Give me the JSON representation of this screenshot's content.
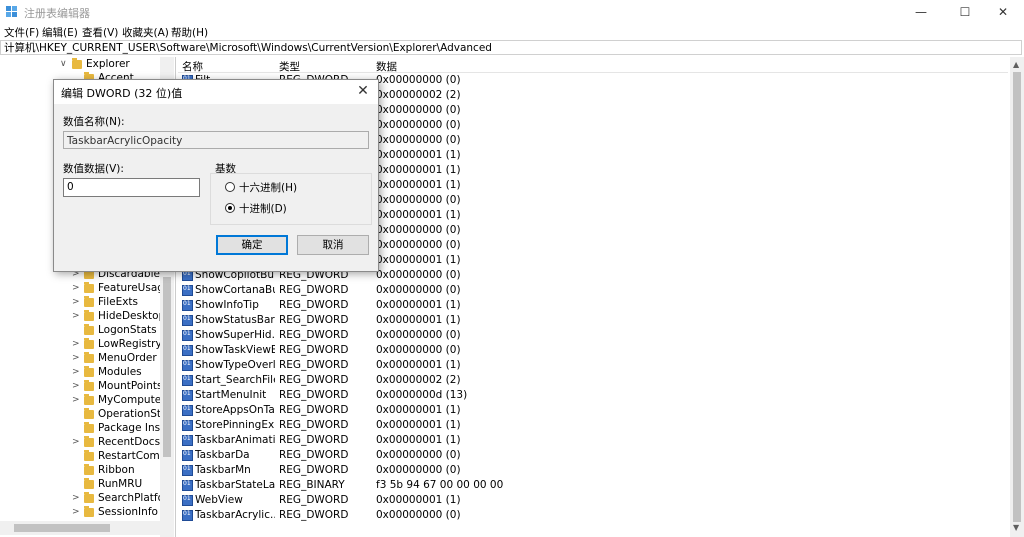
{
  "window": {
    "title": "注册表编辑器",
    "controls": [
      "—",
      "☐",
      "✕"
    ]
  },
  "menu": [
    "文件(F)",
    "编辑(E)",
    "查看(V)",
    "收藏夹(A)",
    "帮助(H)"
  ],
  "address": "计算机\\HKEY_CURRENT_USER\\Software\\Microsoft\\Windows\\CurrentVersion\\Explorer\\Advanced",
  "tree": {
    "root": {
      "label": "Explorer",
      "arrow": "∨"
    },
    "items": [
      {
        "label": "Accent",
        "arrow": ""
      },
      {
        "label": "Discardable",
        "arrow": ">"
      },
      {
        "label": "FeatureUsage",
        "arrow": ">"
      },
      {
        "label": "FileExts",
        "arrow": ">"
      },
      {
        "label": "HideDesktop",
        "arrow": ">"
      },
      {
        "label": "LogonStats",
        "arrow": ""
      },
      {
        "label": "LowRegistry",
        "arrow": ">"
      },
      {
        "label": "MenuOrder",
        "arrow": ">"
      },
      {
        "label": "Modules",
        "arrow": ">"
      },
      {
        "label": "MountPoints2",
        "arrow": ">"
      },
      {
        "label": "MyComputer",
        "arrow": ">"
      },
      {
        "label": "OperationSta",
        "arrow": ""
      },
      {
        "label": "Package Insta",
        "arrow": ""
      },
      {
        "label": "RecentDocs",
        "arrow": ">"
      },
      {
        "label": "RestartComm",
        "arrow": ""
      },
      {
        "label": "Ribbon",
        "arrow": ""
      },
      {
        "label": "RunMRU",
        "arrow": ""
      },
      {
        "label": "SearchPlatfor",
        "arrow": ">"
      },
      {
        "label": "SessionInfo",
        "arrow": ">"
      }
    ]
  },
  "columns": {
    "name": "名称",
    "type": "类型",
    "data": "数据"
  },
  "rows": [
    {
      "name": "Filt",
      "type": "REG_DWORD",
      "data": "0x00000000 (0)"
    },
    {
      "name": "",
      "type": "",
      "data": "0x00000002 (2)"
    },
    {
      "name": "",
      "type": "",
      "data": "0x00000000 (0)"
    },
    {
      "name": "",
      "type": "",
      "data": "0x00000000 (0)"
    },
    {
      "name": "",
      "type": "",
      "data": "0x00000000 (0)"
    },
    {
      "name": "",
      "type": "",
      "data": "0x00000001 (1)"
    },
    {
      "name": "",
      "type": "",
      "data": "0x00000001 (1)"
    },
    {
      "name": "",
      "type": "",
      "data": "0x00000001 (1)"
    },
    {
      "name": "",
      "type": "",
      "data": "0x00000000 (0)"
    },
    {
      "name": "",
      "type": "",
      "data": "0x00000001 (1)"
    },
    {
      "name": "",
      "type": "",
      "data": "0x00000000 (0)"
    },
    {
      "name": "",
      "type": "",
      "data": "0x00000000 (0)"
    },
    {
      "name": "",
      "type": "",
      "data": "0x00000001 (1)"
    },
    {
      "name": "ShowCopilotBu...",
      "type": "REG_DWORD",
      "data": "0x00000000 (0)"
    },
    {
      "name": "ShowCortanaBu...",
      "type": "REG_DWORD",
      "data": "0x00000000 (0)"
    },
    {
      "name": "ShowInfoTip",
      "type": "REG_DWORD",
      "data": "0x00000001 (1)"
    },
    {
      "name": "ShowStatusBar",
      "type": "REG_DWORD",
      "data": "0x00000001 (1)"
    },
    {
      "name": "ShowSuperHid...",
      "type": "REG_DWORD",
      "data": "0x00000000 (0)"
    },
    {
      "name": "ShowTaskViewB...",
      "type": "REG_DWORD",
      "data": "0x00000000 (0)"
    },
    {
      "name": "ShowTypeOverl...",
      "type": "REG_DWORD",
      "data": "0x00000001 (1)"
    },
    {
      "name": "Start_SearchFiles",
      "type": "REG_DWORD",
      "data": "0x00000002 (2)"
    },
    {
      "name": "StartMenuInit",
      "type": "REG_DWORD",
      "data": "0x0000000d (13)"
    },
    {
      "name": "StoreAppsOnTa...",
      "type": "REG_DWORD",
      "data": "0x00000001 (1)"
    },
    {
      "name": "StorePinningEx...",
      "type": "REG_DWORD",
      "data": "0x00000001 (1)"
    },
    {
      "name": "TaskbarAnimati...",
      "type": "REG_DWORD",
      "data": "0x00000001 (1)"
    },
    {
      "name": "TaskbarDa",
      "type": "REG_DWORD",
      "data": "0x00000000 (0)"
    },
    {
      "name": "TaskbarMn",
      "type": "REG_DWORD",
      "data": "0x00000000 (0)"
    },
    {
      "name": "TaskbarStateLa...",
      "type": "REG_BINARY",
      "data": "f3 5b 94 67 00 00 00 00"
    },
    {
      "name": "WebView",
      "type": "REG_DWORD",
      "data": "0x00000001 (1)"
    },
    {
      "name": "TaskbarAcrylic...",
      "type": "REG_DWORD",
      "data": "0x00000000 (0)"
    }
  ],
  "dialog": {
    "title": "编辑 DWORD (32 位)值",
    "close": "✕",
    "name_label": "数值名称(N):",
    "name_value": "TaskbarAcrylicOpacity",
    "data_label": "数值数据(V):",
    "data_value": "0",
    "base_label": "基数",
    "hex_label": "十六进制(H)",
    "dec_label": "十进制(D)",
    "ok": "确定",
    "cancel": "取消"
  },
  "scroll": {
    "up": "▲",
    "down": "▼"
  }
}
